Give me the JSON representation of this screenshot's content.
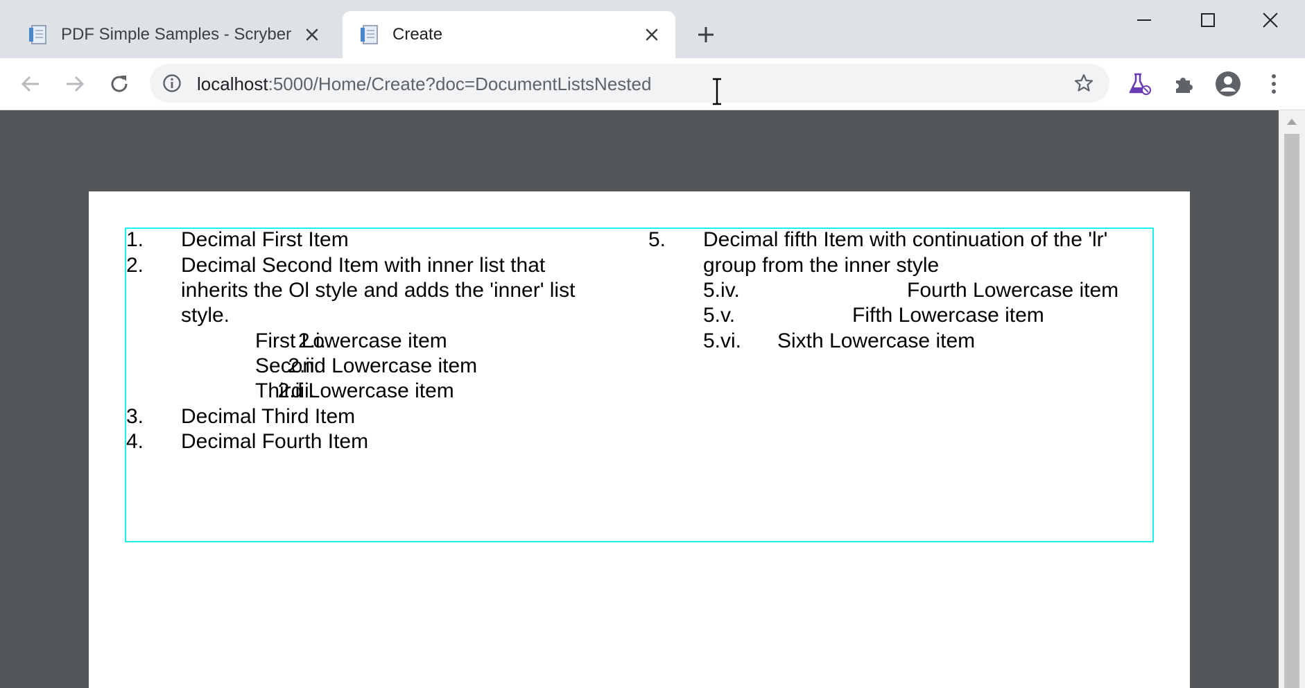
{
  "tabs": [
    {
      "title": "PDF Simple Samples - Scryber",
      "active": false
    },
    {
      "title": "Create",
      "active": true
    }
  ],
  "address_bar": {
    "host": "localhost",
    "path": ":5000/Home/Create?doc=DocumentListsNested"
  },
  "document": {
    "left_column": [
      {
        "marker": "1.",
        "lines": [
          "Decimal First Item"
        ]
      },
      {
        "marker": "2.",
        "lines": [
          "Decimal Second Item with inner list that",
          "inherits the Ol style and adds the 'inner' list",
          "style."
        ]
      },
      {
        "marker": "2.i.",
        "lines": [
          "First Lowercase item"
        ]
      },
      {
        "marker": "2.ii.",
        "lines": [
          "Second Lowercase item"
        ]
      },
      {
        "marker": "2.iii.",
        "lines": [
          "Third Lowercase item"
        ]
      },
      {
        "marker": "3.",
        "lines": [
          "Decimal Third Item"
        ]
      },
      {
        "marker": "4.",
        "lines": [
          "Decimal Fourth Item"
        ]
      }
    ],
    "right_column": [
      {
        "marker": "5.",
        "lines": [
          "Decimal fifth Item with continuation of the 'lr'",
          "group from the inner style"
        ]
      },
      {
        "marker": "5.iv.",
        "lines": [
          "Fourth Lowercase item"
        ]
      },
      {
        "marker": "5.v.",
        "lines": [
          "Fifth Lowercase item"
        ]
      },
      {
        "marker": "5.vi.",
        "lines": [
          "Sixth Lowercase item"
        ]
      }
    ]
  },
  "icons": {
    "favicon": "document-icon",
    "close": "close-icon",
    "new_tab": "plus-icon",
    "minimize": "minimize-icon",
    "maximize": "maximize-icon",
    "window_close": "window-close-icon",
    "back": "back-arrow-icon",
    "forward": "forward-arrow-icon",
    "reload": "reload-icon",
    "site_info": "info-icon",
    "bookmark": "star-icon",
    "labs": "flask-icon",
    "extensions": "puzzle-icon",
    "profile": "account-icon",
    "menu": "more-vert-icon"
  },
  "colors": {
    "frame_border": "#19f0f0",
    "tab_strip": "#dee1e6",
    "viewer_bg": "#525659",
    "labs_accent": "#6a3ab2"
  }
}
